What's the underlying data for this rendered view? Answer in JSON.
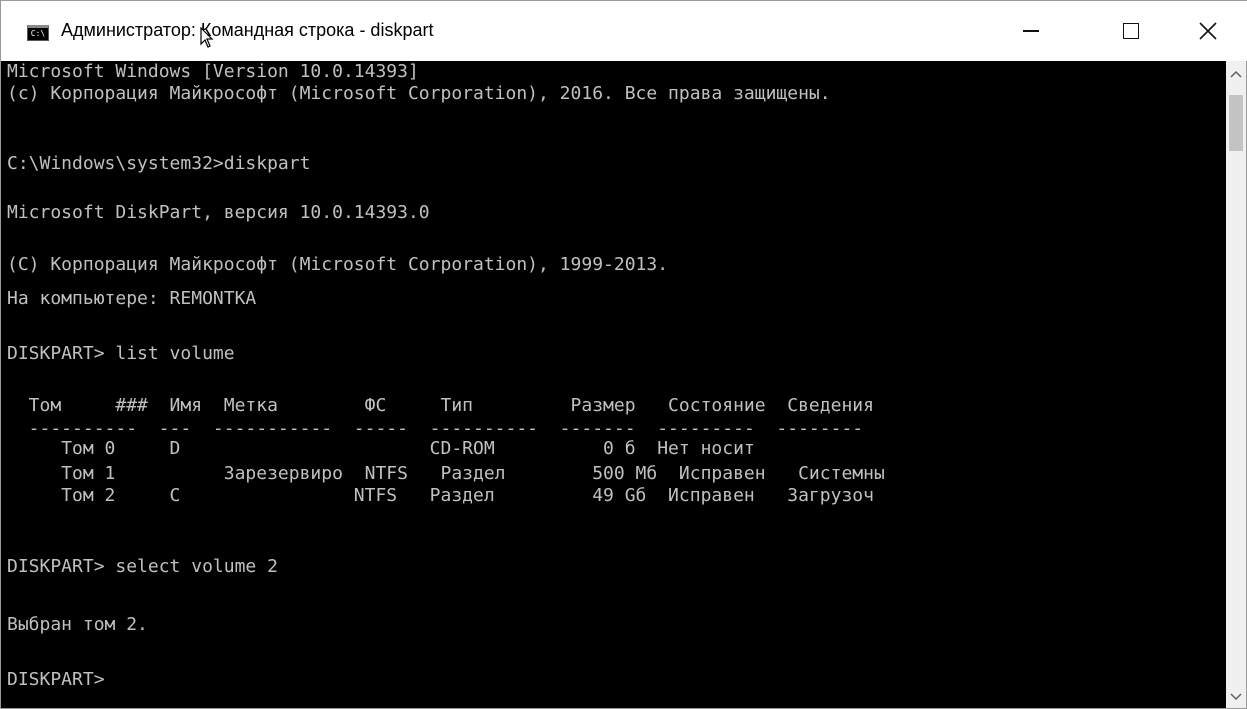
{
  "window": {
    "title": "Администратор: Командная строка - diskpart",
    "icon_text": "C:\\"
  },
  "controls": {
    "minimize": "minimize-icon",
    "maximize": "maximize-icon",
    "close": "close-icon"
  },
  "console": {
    "lines": [
      "Microsoft Windows [Version 10.0.14393]",
      "(c) Корпорация Майкрософт (Microsoft Corporation), 2016. Все права защищены.",
      "",
      "C:\\Windows\\system32>diskpart",
      "",
      "Microsoft DiskPart, версия 10.0.14393.0",
      "",
      "(C) Корпорация Майкрософт (Microsoft Corporation), 1999-2013.",
      "На компьютере: REMONTKA",
      "",
      "DISKPART> list volume",
      "",
      "  Том     ###  Имя  Метка        ФС     Тип         Размер   Состояние  Сведения",
      "  ----------  ---  -----------  -----  ----------  -------  ---------  --------",
      "     Том 0     D                       CD-ROM          0 б  Нет носит",
      "     Том 1          Зарезервиро  NTFS   Раздел        500 Мб  Исправен   Системны",
      "     Том 2     C                NTFS   Раздел         49 Gб  Исправен   Загрузоч",
      "",
      "DISKPART> select volume 2",
      "",
      "Выбран том 2.",
      "",
      "DISKPART> "
    ]
  },
  "colors": {
    "console_bg": "#000000",
    "console_text": "#c0c0c0",
    "titlebar_bg": "#ffffff"
  }
}
